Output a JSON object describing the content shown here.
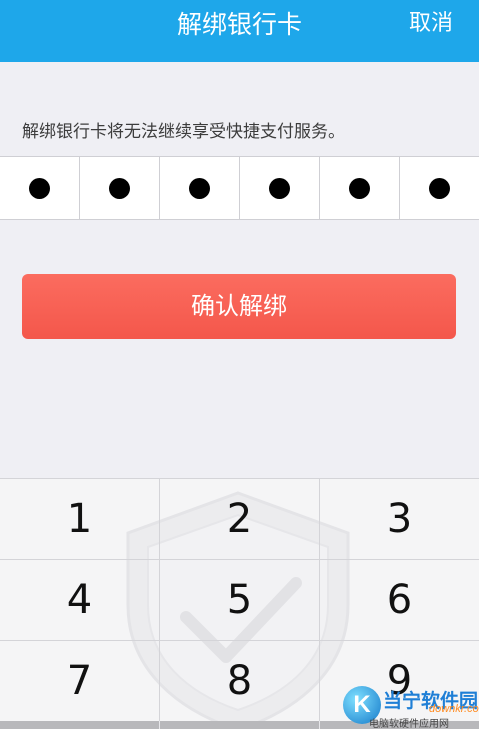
{
  "header": {
    "title": "解绑银行卡",
    "cancel_label": "取消",
    "background_color": "#1ea7ea"
  },
  "info_text": "解绑银行卡将无法继续享受快捷支付服务。",
  "pin": {
    "length": 6,
    "filled": 6
  },
  "confirm_button": {
    "label": "确认解绑",
    "color": "#f4574b"
  },
  "keypad": {
    "keys": [
      "1",
      "2",
      "3",
      "4",
      "5",
      "6",
      "7",
      "8",
      "9"
    ],
    "watermark_icon": "shield-check-icon"
  },
  "watermark_logo": {
    "icon": "k-logo-icon",
    "icon_text": "K",
    "name": "当宁软件园",
    "domain": "downkr.com",
    "tagline": "电脑软硬件应用网"
  }
}
